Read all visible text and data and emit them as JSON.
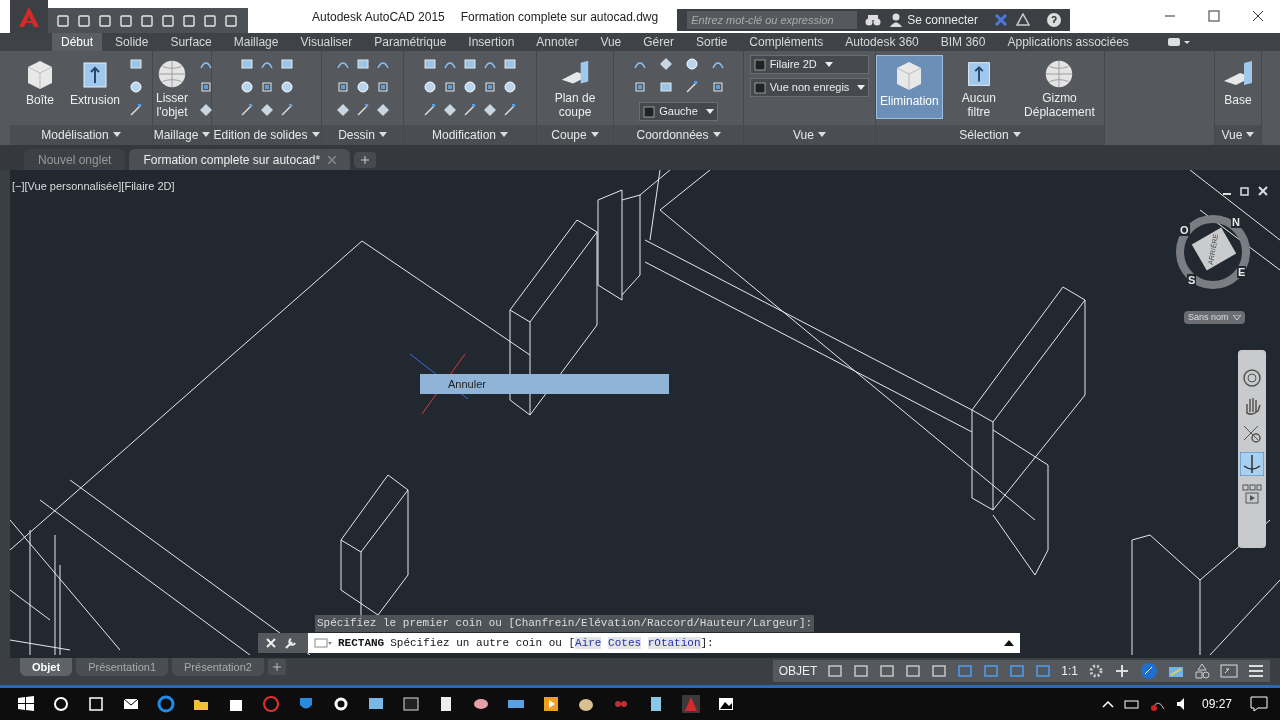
{
  "title_bar": {
    "app_title": "Autodesk AutoCAD 2015",
    "file_title": "Formation complete sur autocad.dwg",
    "search": {
      "placeholder": "Entrez mot-clé ou expression"
    },
    "sign_in": "Se connecter"
  },
  "ribbon_tabs": [
    {
      "label": "Début",
      "selected": true
    },
    {
      "label": "Solide",
      "selected": false
    },
    {
      "label": "Surface",
      "selected": false
    },
    {
      "label": "Maillage",
      "selected": false
    },
    {
      "label": "Visualiser",
      "selected": false
    },
    {
      "label": "Paramétrique",
      "selected": false
    },
    {
      "label": "Insertion",
      "selected": false
    },
    {
      "label": "Annoter",
      "selected": false
    },
    {
      "label": "Vue",
      "selected": false
    },
    {
      "label": "Gérer",
      "selected": false
    },
    {
      "label": "Sortie",
      "selected": false
    },
    {
      "label": "Compléments",
      "selected": false
    },
    {
      "label": "Autodesk 360",
      "selected": false
    },
    {
      "label": "BIM 360",
      "selected": false
    },
    {
      "label": "Applications associées",
      "selected": false
    }
  ],
  "ribbon_panels": [
    {
      "title": "Modélisation",
      "items": [
        {
          "kind": "large",
          "label": "Boîte",
          "selected": false
        },
        {
          "kind": "large",
          "label": "Extrusion",
          "selected": false
        },
        {
          "kind": "icons"
        }
      ]
    },
    {
      "title": "Maillage",
      "items": [
        {
          "kind": "large",
          "label": "Lisser l'objet",
          "selected": false
        },
        {
          "kind": "icons"
        }
      ]
    },
    {
      "title": "Edition de solides",
      "items": [
        {
          "kind": "icons"
        },
        {
          "kind": "icons"
        },
        {
          "kind": "icons"
        }
      ]
    },
    {
      "title": "Dessin",
      "items": [
        {
          "kind": "icons"
        },
        {
          "kind": "icons"
        },
        {
          "kind": "icons"
        }
      ]
    },
    {
      "title": "Modification",
      "items": [
        {
          "kind": "icons"
        },
        {
          "kind": "icons"
        },
        {
          "kind": "icons"
        },
        {
          "kind": "icons"
        },
        {
          "kind": "icons"
        }
      ]
    },
    {
      "title": "Coupe",
      "items": [
        {
          "kind": "large",
          "label": "Plan de coupe",
          "selected": false
        }
      ]
    },
    {
      "title": "Coordonnées",
      "items": [
        {
          "kind": "icons"
        },
        {
          "kind": "icons"
        },
        {
          "kind": "icons"
        },
        {
          "kind": "icons"
        },
        {
          "kind": "dropdown",
          "label": "Gauche"
        }
      ]
    },
    {
      "title": "Vue",
      "items": [
        {
          "kind": "dropdown",
          "label": "Filaire 2D"
        },
        {
          "kind": "dropdown",
          "label": "Vue non enregis"
        }
      ]
    },
    {
      "title": "Sélection",
      "items": [
        {
          "kind": "large",
          "label": "Elimination",
          "selected": true
        },
        {
          "kind": "large",
          "label": "Aucun filtre",
          "selected": false
        },
        {
          "kind": "large",
          "label": "Gizmo Déplacement",
          "selected": false
        }
      ]
    },
    {
      "title": "Vue",
      "items": [
        {
          "kind": "large",
          "label": "Base",
          "selected": false
        }
      ]
    }
  ],
  "document_tabs": [
    {
      "label": "Nouvel onglet",
      "selected": false
    },
    {
      "label": "Formation complete sur autocad*",
      "selected": true
    }
  ],
  "viewport": {
    "view_label": "[−][Vue personnalisée][Filaire 2D]",
    "viewcube_face": "ARRIÈRE",
    "compass": [
      "N",
      "E",
      "S",
      "O"
    ],
    "ucs_name": "Sans nom",
    "tooltip": "Annuler"
  },
  "command_line": {
    "history": "Spécifiez le premier coin ou [Chanfrein/Elévation/Raccord/Hauteur/Largeur]:",
    "command": "RECTANG",
    "prompt": "Spécifiez un autre coin ou [",
    "options": [
      "Aire",
      "Cotes",
      "rOtation"
    ],
    "suffix": "]:"
  },
  "layout_tabs": [
    {
      "label": "Objet",
      "selected": true
    },
    {
      "label": "Présentation1",
      "selected": false
    },
    {
      "label": "Présentation2",
      "selected": false
    }
  ],
  "status_bar": {
    "space": "OBJET",
    "scale": "1:1"
  },
  "taskbar": {
    "clock": "09:27"
  }
}
